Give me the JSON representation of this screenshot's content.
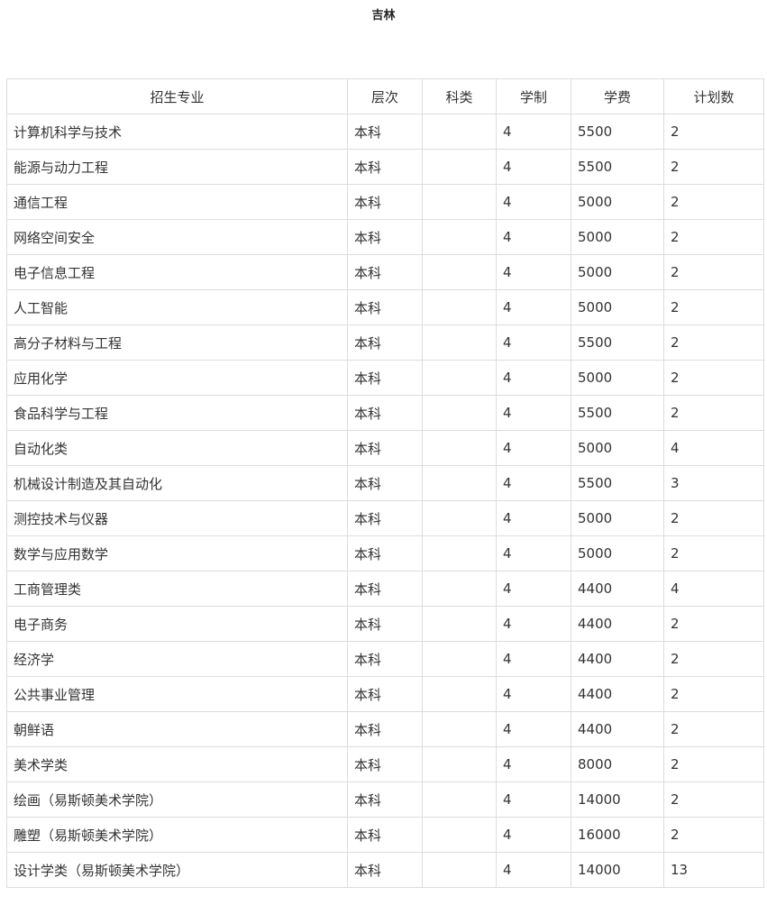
{
  "title": "吉林",
  "table": {
    "headers": [
      "招生专业",
      "层次",
      "科类",
      "学制",
      "学费",
      "计划数"
    ],
    "rows": [
      [
        "计算机科学与技术",
        "本科",
        "",
        "4",
        "5500",
        "2"
      ],
      [
        "能源与动力工程",
        "本科",
        "",
        "4",
        "5500",
        "2"
      ],
      [
        "通信工程",
        "本科",
        "",
        "4",
        "5000",
        "2"
      ],
      [
        "网络空间安全",
        "本科",
        "",
        "4",
        "5000",
        "2"
      ],
      [
        "电子信息工程",
        "本科",
        "",
        "4",
        "5000",
        "2"
      ],
      [
        "人工智能",
        "本科",
        "",
        "4",
        "5000",
        "2"
      ],
      [
        "高分子材料与工程",
        "本科",
        "",
        "4",
        "5500",
        "2"
      ],
      [
        "应用化学",
        "本科",
        "",
        "4",
        "5000",
        "2"
      ],
      [
        "食品科学与工程",
        "本科",
        "",
        "4",
        "5500",
        "2"
      ],
      [
        "自动化类",
        "本科",
        "",
        "4",
        "5000",
        "4"
      ],
      [
        "机械设计制造及其自动化",
        "本科",
        "",
        "4",
        "5500",
        "3"
      ],
      [
        "测控技术与仪器",
        "本科",
        "",
        "4",
        "5000",
        "2"
      ],
      [
        "数学与应用数学",
        "本科",
        "",
        "4",
        "5000",
        "2"
      ],
      [
        "工商管理类",
        "本科",
        "",
        "4",
        "4400",
        "4"
      ],
      [
        "电子商务",
        "本科",
        "",
        "4",
        "4400",
        "2"
      ],
      [
        "经济学",
        "本科",
        "",
        "4",
        "4400",
        "2"
      ],
      [
        "公共事业管理",
        "本科",
        "",
        "4",
        "4400",
        "2"
      ],
      [
        "朝鲜语",
        "本科",
        "",
        "4",
        "4400",
        "2"
      ],
      [
        "美术学类",
        "本科",
        "",
        "4",
        "8000",
        "2"
      ],
      [
        "绘画（易斯顿美术学院）",
        "本科",
        "",
        "4",
        "14000",
        "2"
      ],
      [
        "雕塑（易斯顿美术学院）",
        "本科",
        "",
        "4",
        "16000",
        "2"
      ],
      [
        "设计学类（易斯顿美术学院）",
        "本科",
        "",
        "4",
        "14000",
        "13"
      ]
    ]
  }
}
